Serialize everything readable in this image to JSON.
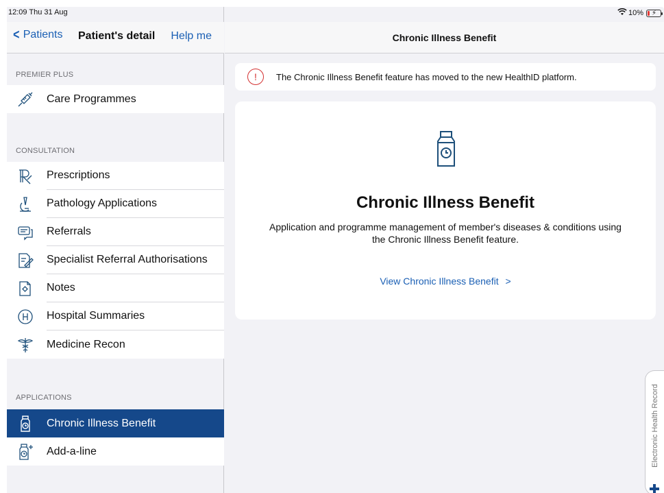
{
  "status_bar": {
    "time": "12:09",
    "date": "Thu 31 Aug",
    "battery": "10%"
  },
  "sidebar": {
    "back_label": "Patients",
    "title": "Patient's detail",
    "help_label": "Help me",
    "sections": [
      {
        "header": "PREMIER PLUS",
        "items": [
          {
            "label": "Care Programmes",
            "icon": "syringe-icon"
          }
        ]
      },
      {
        "header": "CONSULTATION",
        "items": [
          {
            "label": "Prescriptions",
            "icon": "rx-icon"
          },
          {
            "label": "Pathology Applications",
            "icon": "microscope-icon"
          },
          {
            "label": "Referrals",
            "icon": "chat-icon"
          },
          {
            "label": "Specialist Referral Authorisations",
            "icon": "document-edit-icon"
          },
          {
            "label": "Notes",
            "icon": "notes-icon"
          },
          {
            "label": "Hospital Summaries",
            "icon": "hospital-icon"
          },
          {
            "label": "Medicine Recon",
            "icon": "caduceus-icon"
          }
        ]
      },
      {
        "header": "APPLICATIONS",
        "items": [
          {
            "label": "Chronic Illness Benefit",
            "icon": "medicine-bottle-icon",
            "selected": true
          },
          {
            "label": "Add-a-line",
            "icon": "medicine-bottle-plus-icon"
          }
        ]
      }
    ]
  },
  "main": {
    "title": "Chronic Illness Benefit",
    "banner_text": "The Chronic Illness Benefit feature has moved to the new HealthID platform.",
    "card": {
      "title": "Chronic Illness Benefit",
      "description": "Application and programme management of member's diseases & conditions using the Chronic Illness Benefit feature.",
      "link_label": "View Chronic Illness Benefit",
      "link_chevron": ">"
    },
    "side_tab_label": "Electronic Health Record"
  },
  "colors": {
    "accent": "#1a5fb4",
    "selected_row": "#15488a",
    "alert": "#d32f2f",
    "background": "#f2f2f6"
  }
}
